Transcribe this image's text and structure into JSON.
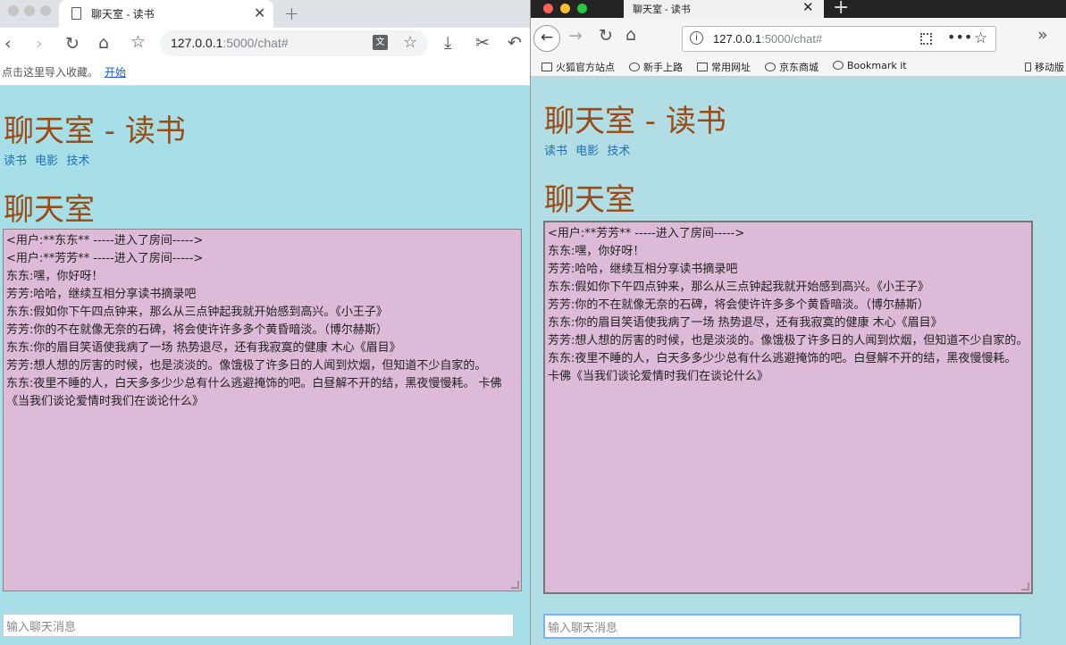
{
  "tab_title": "聊天室 - 读书",
  "url_host": "127.0.0.1",
  "url_path": ":5000/chat#",
  "left_browser": {
    "bookmark_prompt": "点击这里导入收藏。",
    "bookmark_link": "开始",
    "translate_icon": "文"
  },
  "right_browser": {
    "bookmarks": [
      "火狐官方站点",
      "新手上路",
      "常用网址",
      "京东商城",
      "Bookmark it",
      "移动版"
    ]
  },
  "page": {
    "title": "聊天室 - 读书",
    "nav": [
      "读书",
      "电影",
      "技术"
    ],
    "section_title": "聊天室",
    "input_placeholder": "输入聊天消息"
  },
  "left_chat": [
    "<用户:**东东** -----进入了房间----->",
    "<用户:**芳芳** -----进入了房间----->",
    "东东:嘿，你好呀！",
    "芳芳:哈哈，继续互相分享读书摘录吧",
    "东东:假如你下午四点钟来，那么从三点钟起我就开始感到高兴。《小王子》",
    "芳芳:你的不在就像无奈的石碑，将会使许许多多个黄昏暗淡。（博尔赫斯）",
    "东东:你的眉目笑语使我病了一场 热势退尽，还有我寂寞的健康 木心《眉目》",
    "芳芳:想人想的厉害的时候，也是淡淡的。像饿极了许多日的人闻到炊烟，但知道不少自家的。",
    "东东:夜里不睡的人，白天多多少少总有什么逃避掩饰的吧。白昼解不开的结，黑夜慢慢耗。 卡佛《当我们谈论爱情时我们在谈论什么》"
  ],
  "right_chat": [
    "<用户:**芳芳** -----进入了房间----->",
    "东东:嘿，你好呀！",
    "芳芳:哈哈，继续互相分享读书摘录吧",
    "东东:假如你下午四点钟来，那么从三点钟起我就开始感到高兴。《小王子》",
    "芳芳:你的不在就像无奈的石碑，将会使许许多多个黄昏暗淡。（博尔赫斯）",
    "东东:你的眉目笑语使我病了一场 热势退尽，还有我寂寞的健康 木心《眉目》",
    "芳芳:想人想的厉害的时候，也是淡淡的。像饿极了许多日的人闻到炊烟，但知道不少自家的。",
    "东东:夜里不睡的人，白天多多少少总有什么逃避掩饰的吧。白昼解不开的结，黑夜慢慢耗。 卡佛《当我们谈论爱情时我们在谈论什么》"
  ],
  "colors": {
    "page_bg_left": "#a6dfe7",
    "page_bg_right": "#b1dde4",
    "heading": "#9d4b14",
    "nav_link": "#1f6fb5",
    "chat_bg": "#dcbad8"
  }
}
